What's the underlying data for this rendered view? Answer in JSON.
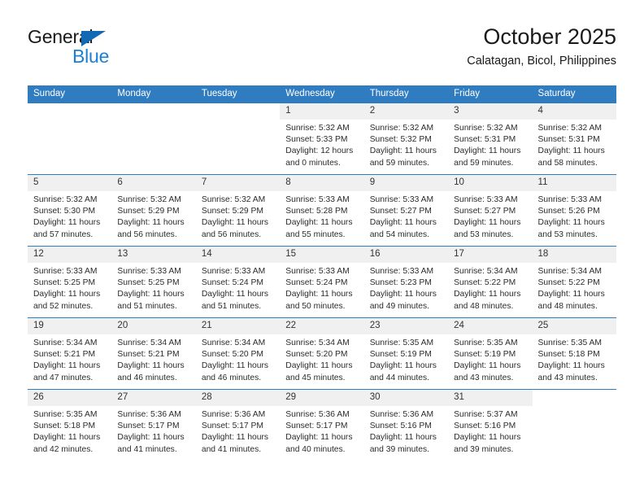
{
  "brand": {
    "word_one": "General",
    "word_two": "Blue",
    "triangle_icon": "blue-triangle-icon",
    "accent_dark": "#1268b3",
    "accent_light": "#1c7fd4"
  },
  "header": {
    "month_title": "October 2025",
    "location": "Calatagan, Bicol, Philippines"
  },
  "theme": {
    "header_blue": "#2f7cc1",
    "daynum_band": "#f0f0f0",
    "text": "#2b2b2b"
  },
  "weekday_headers": [
    "Sunday",
    "Monday",
    "Tuesday",
    "Wednesday",
    "Thursday",
    "Friday",
    "Saturday"
  ],
  "labels": {
    "sunrise_prefix": "Sunrise:",
    "sunset_prefix": "Sunset:",
    "daylight_prefix": "Daylight:"
  },
  "weeks": [
    [
      {
        "day": "",
        "sunrise": "",
        "sunset": "",
        "daylight_line1": "",
        "daylight_line2": "",
        "blank": true
      },
      {
        "day": "",
        "sunrise": "",
        "sunset": "",
        "daylight_line1": "",
        "daylight_line2": "",
        "blank": true
      },
      {
        "day": "",
        "sunrise": "",
        "sunset": "",
        "daylight_line1": "",
        "daylight_line2": "",
        "blank": true
      },
      {
        "day": "1",
        "sunrise": "Sunrise: 5:32 AM",
        "sunset": "Sunset: 5:33 PM",
        "daylight_line1": "Daylight: 12 hours",
        "daylight_line2": "and 0 minutes.",
        "blank": false
      },
      {
        "day": "2",
        "sunrise": "Sunrise: 5:32 AM",
        "sunset": "Sunset: 5:32 PM",
        "daylight_line1": "Daylight: 11 hours",
        "daylight_line2": "and 59 minutes.",
        "blank": false
      },
      {
        "day": "3",
        "sunrise": "Sunrise: 5:32 AM",
        "sunset": "Sunset: 5:31 PM",
        "daylight_line1": "Daylight: 11 hours",
        "daylight_line2": "and 59 minutes.",
        "blank": false
      },
      {
        "day": "4",
        "sunrise": "Sunrise: 5:32 AM",
        "sunset": "Sunset: 5:31 PM",
        "daylight_line1": "Daylight: 11 hours",
        "daylight_line2": "and 58 minutes.",
        "blank": false
      }
    ],
    [
      {
        "day": "5",
        "sunrise": "Sunrise: 5:32 AM",
        "sunset": "Sunset: 5:30 PM",
        "daylight_line1": "Daylight: 11 hours",
        "daylight_line2": "and 57 minutes.",
        "blank": false
      },
      {
        "day": "6",
        "sunrise": "Sunrise: 5:32 AM",
        "sunset": "Sunset: 5:29 PM",
        "daylight_line1": "Daylight: 11 hours",
        "daylight_line2": "and 56 minutes.",
        "blank": false
      },
      {
        "day": "7",
        "sunrise": "Sunrise: 5:32 AM",
        "sunset": "Sunset: 5:29 PM",
        "daylight_line1": "Daylight: 11 hours",
        "daylight_line2": "and 56 minutes.",
        "blank": false
      },
      {
        "day": "8",
        "sunrise": "Sunrise: 5:33 AM",
        "sunset": "Sunset: 5:28 PM",
        "daylight_line1": "Daylight: 11 hours",
        "daylight_line2": "and 55 minutes.",
        "blank": false
      },
      {
        "day": "9",
        "sunrise": "Sunrise: 5:33 AM",
        "sunset": "Sunset: 5:27 PM",
        "daylight_line1": "Daylight: 11 hours",
        "daylight_line2": "and 54 minutes.",
        "blank": false
      },
      {
        "day": "10",
        "sunrise": "Sunrise: 5:33 AM",
        "sunset": "Sunset: 5:27 PM",
        "daylight_line1": "Daylight: 11 hours",
        "daylight_line2": "and 53 minutes.",
        "blank": false
      },
      {
        "day": "11",
        "sunrise": "Sunrise: 5:33 AM",
        "sunset": "Sunset: 5:26 PM",
        "daylight_line1": "Daylight: 11 hours",
        "daylight_line2": "and 53 minutes.",
        "blank": false
      }
    ],
    [
      {
        "day": "12",
        "sunrise": "Sunrise: 5:33 AM",
        "sunset": "Sunset: 5:25 PM",
        "daylight_line1": "Daylight: 11 hours",
        "daylight_line2": "and 52 minutes.",
        "blank": false
      },
      {
        "day": "13",
        "sunrise": "Sunrise: 5:33 AM",
        "sunset": "Sunset: 5:25 PM",
        "daylight_line1": "Daylight: 11 hours",
        "daylight_line2": "and 51 minutes.",
        "blank": false
      },
      {
        "day": "14",
        "sunrise": "Sunrise: 5:33 AM",
        "sunset": "Sunset: 5:24 PM",
        "daylight_line1": "Daylight: 11 hours",
        "daylight_line2": "and 51 minutes.",
        "blank": false
      },
      {
        "day": "15",
        "sunrise": "Sunrise: 5:33 AM",
        "sunset": "Sunset: 5:24 PM",
        "daylight_line1": "Daylight: 11 hours",
        "daylight_line2": "and 50 minutes.",
        "blank": false
      },
      {
        "day": "16",
        "sunrise": "Sunrise: 5:33 AM",
        "sunset": "Sunset: 5:23 PM",
        "daylight_line1": "Daylight: 11 hours",
        "daylight_line2": "and 49 minutes.",
        "blank": false
      },
      {
        "day": "17",
        "sunrise": "Sunrise: 5:34 AM",
        "sunset": "Sunset: 5:22 PM",
        "daylight_line1": "Daylight: 11 hours",
        "daylight_line2": "and 48 minutes.",
        "blank": false
      },
      {
        "day": "18",
        "sunrise": "Sunrise: 5:34 AM",
        "sunset": "Sunset: 5:22 PM",
        "daylight_line1": "Daylight: 11 hours",
        "daylight_line2": "and 48 minutes.",
        "blank": false
      }
    ],
    [
      {
        "day": "19",
        "sunrise": "Sunrise: 5:34 AM",
        "sunset": "Sunset: 5:21 PM",
        "daylight_line1": "Daylight: 11 hours",
        "daylight_line2": "and 47 minutes.",
        "blank": false
      },
      {
        "day": "20",
        "sunrise": "Sunrise: 5:34 AM",
        "sunset": "Sunset: 5:21 PM",
        "daylight_line1": "Daylight: 11 hours",
        "daylight_line2": "and 46 minutes.",
        "blank": false
      },
      {
        "day": "21",
        "sunrise": "Sunrise: 5:34 AM",
        "sunset": "Sunset: 5:20 PM",
        "daylight_line1": "Daylight: 11 hours",
        "daylight_line2": "and 46 minutes.",
        "blank": false
      },
      {
        "day": "22",
        "sunrise": "Sunrise: 5:34 AM",
        "sunset": "Sunset: 5:20 PM",
        "daylight_line1": "Daylight: 11 hours",
        "daylight_line2": "and 45 minutes.",
        "blank": false
      },
      {
        "day": "23",
        "sunrise": "Sunrise: 5:35 AM",
        "sunset": "Sunset: 5:19 PM",
        "daylight_line1": "Daylight: 11 hours",
        "daylight_line2": "and 44 minutes.",
        "blank": false
      },
      {
        "day": "24",
        "sunrise": "Sunrise: 5:35 AM",
        "sunset": "Sunset: 5:19 PM",
        "daylight_line1": "Daylight: 11 hours",
        "daylight_line2": "and 43 minutes.",
        "blank": false
      },
      {
        "day": "25",
        "sunrise": "Sunrise: 5:35 AM",
        "sunset": "Sunset: 5:18 PM",
        "daylight_line1": "Daylight: 11 hours",
        "daylight_line2": "and 43 minutes.",
        "blank": false
      }
    ],
    [
      {
        "day": "26",
        "sunrise": "Sunrise: 5:35 AM",
        "sunset": "Sunset: 5:18 PM",
        "daylight_line1": "Daylight: 11 hours",
        "daylight_line2": "and 42 minutes.",
        "blank": false
      },
      {
        "day": "27",
        "sunrise": "Sunrise: 5:36 AM",
        "sunset": "Sunset: 5:17 PM",
        "daylight_line1": "Daylight: 11 hours",
        "daylight_line2": "and 41 minutes.",
        "blank": false
      },
      {
        "day": "28",
        "sunrise": "Sunrise: 5:36 AM",
        "sunset": "Sunset: 5:17 PM",
        "daylight_line1": "Daylight: 11 hours",
        "daylight_line2": "and 41 minutes.",
        "blank": false
      },
      {
        "day": "29",
        "sunrise": "Sunrise: 5:36 AM",
        "sunset": "Sunset: 5:17 PM",
        "daylight_line1": "Daylight: 11 hours",
        "daylight_line2": "and 40 minutes.",
        "blank": false
      },
      {
        "day": "30",
        "sunrise": "Sunrise: 5:36 AM",
        "sunset": "Sunset: 5:16 PM",
        "daylight_line1": "Daylight: 11 hours",
        "daylight_line2": "and 39 minutes.",
        "blank": false
      },
      {
        "day": "31",
        "sunrise": "Sunrise: 5:37 AM",
        "sunset": "Sunset: 5:16 PM",
        "daylight_line1": "Daylight: 11 hours",
        "daylight_line2": "and 39 minutes.",
        "blank": false
      },
      {
        "day": "",
        "sunrise": "",
        "sunset": "",
        "daylight_line1": "",
        "daylight_line2": "",
        "blank": true
      }
    ]
  ]
}
